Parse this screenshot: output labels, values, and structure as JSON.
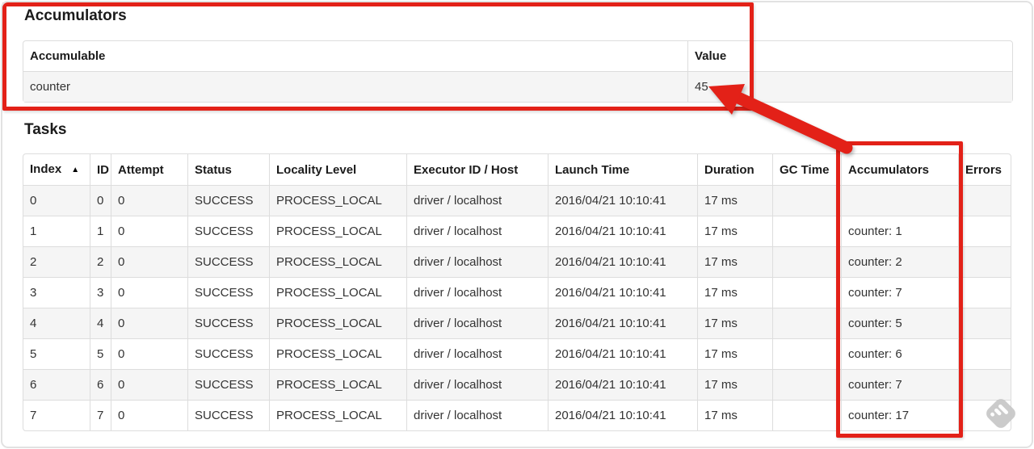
{
  "accumulators_section": {
    "title": "Accumulators",
    "table": {
      "headers": [
        "Accumulable",
        "Value"
      ],
      "rows": [
        [
          "counter",
          "45"
        ]
      ]
    }
  },
  "tasks_section": {
    "title": "Tasks",
    "table": {
      "headers": [
        "Index",
        "ID",
        "Attempt",
        "Status",
        "Locality Level",
        "Executor ID / Host",
        "Launch Time",
        "Duration",
        "GC Time",
        "Accumulators",
        "Errors"
      ],
      "sort_icon": "▲",
      "sorted_column": "Index",
      "rows": [
        [
          "0",
          "0",
          "0",
          "SUCCESS",
          "PROCESS_LOCAL",
          "driver / localhost",
          "2016/04/21 10:10:41",
          "17 ms",
          "",
          "",
          ""
        ],
        [
          "1",
          "1",
          "0",
          "SUCCESS",
          "PROCESS_LOCAL",
          "driver / localhost",
          "2016/04/21 10:10:41",
          "17 ms",
          "",
          "counter: 1",
          ""
        ],
        [
          "2",
          "2",
          "0",
          "SUCCESS",
          "PROCESS_LOCAL",
          "driver / localhost",
          "2016/04/21 10:10:41",
          "17 ms",
          "",
          "counter: 2",
          ""
        ],
        [
          "3",
          "3",
          "0",
          "SUCCESS",
          "PROCESS_LOCAL",
          "driver / localhost",
          "2016/04/21 10:10:41",
          "17 ms",
          "",
          "counter: 7",
          ""
        ],
        [
          "4",
          "4",
          "0",
          "SUCCESS",
          "PROCESS_LOCAL",
          "driver / localhost",
          "2016/04/21 10:10:41",
          "17 ms",
          "",
          "counter: 5",
          ""
        ],
        [
          "5",
          "5",
          "0",
          "SUCCESS",
          "PROCESS_LOCAL",
          "driver / localhost",
          "2016/04/21 10:10:41",
          "17 ms",
          "",
          "counter: 6",
          ""
        ],
        [
          "6",
          "6",
          "0",
          "SUCCESS",
          "PROCESS_LOCAL",
          "driver / localhost",
          "2016/04/21 10:10:41",
          "17 ms",
          "",
          "counter: 7",
          ""
        ],
        [
          "7",
          "7",
          "0",
          "SUCCESS",
          "PROCESS_LOCAL",
          "driver / localhost",
          "2016/04/21 10:10:41",
          "17 ms",
          "",
          "counter: 17",
          ""
        ]
      ]
    }
  },
  "annotations": {
    "highlight_color": "#e32118"
  }
}
